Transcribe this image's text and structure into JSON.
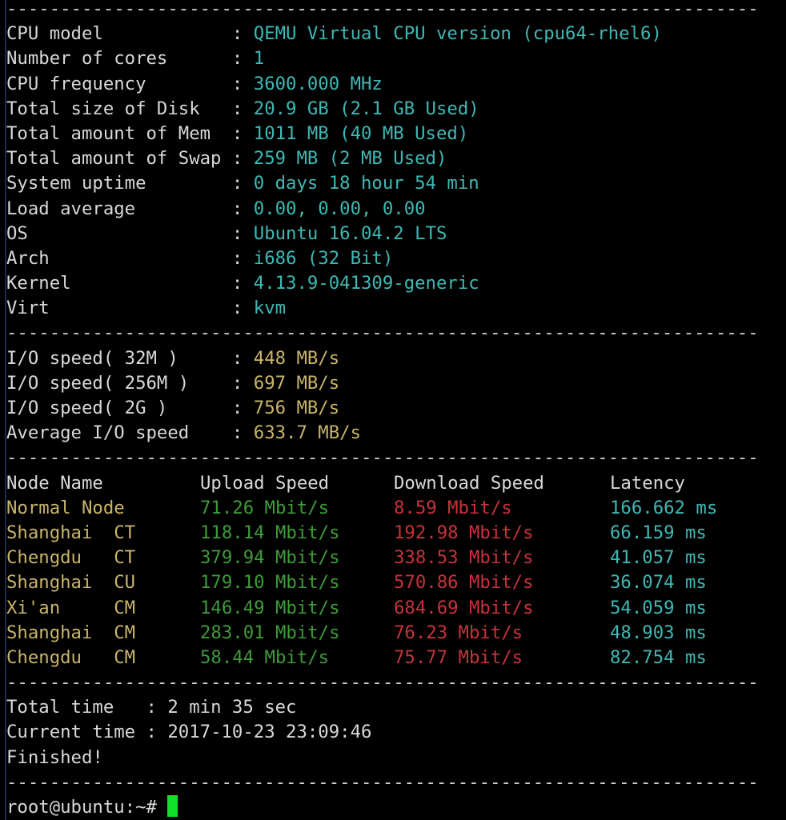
{
  "separator": "----------------------------------------------------------------------",
  "system_info": [
    {
      "label": "CPU model           ",
      "value": "QEMU Virtual CPU version (cpu64-rhel6)"
    },
    {
      "label": "Number of cores     ",
      "value": "1"
    },
    {
      "label": "CPU frequency       ",
      "value": "3600.000 MHz"
    },
    {
      "label": "Total size of Disk  ",
      "value": "20.9 GB (2.1 GB Used)"
    },
    {
      "label": "Total amount of Mem ",
      "value": "1011 MB (40 MB Used)"
    },
    {
      "label": "Total amount of Swap",
      "value": "259 MB (2 MB Used)"
    },
    {
      "label": "System uptime       ",
      "value": "0 days 18 hour 54 min"
    },
    {
      "label": "Load average        ",
      "value": "0.00, 0.00, 0.00"
    },
    {
      "label": "OS                  ",
      "value": "Ubuntu 16.04.2 LTS"
    },
    {
      "label": "Arch                ",
      "value": "i686 (32 Bit)"
    },
    {
      "label": "Kernel              ",
      "value": "4.13.9-041309-generic"
    },
    {
      "label": "Virt                ",
      "value": "kvm"
    }
  ],
  "io_info": [
    {
      "label": "I/O speed( 32M )    ",
      "value": "448 MB/s"
    },
    {
      "label": "I/O speed( 256M )   ",
      "value": "697 MB/s"
    },
    {
      "label": "I/O speed( 2G )     ",
      "value": "756 MB/s"
    },
    {
      "label": "Average I/O speed   ",
      "value": "633.7 MB/s"
    }
  ],
  "colon": " : ",
  "speed_table": {
    "headers": [
      "Node Name",
      "Upload Speed",
      "Download Speed",
      "Latency"
    ],
    "rows": [
      {
        "node": "Normal Node",
        "upload": "71.26 Mbit/s",
        "download": "8.59 Mbit/s",
        "latency": "166.662 ms"
      },
      {
        "node": "Shanghai  CT",
        "upload": "118.14 Mbit/s",
        "download": "192.98 Mbit/s",
        "latency": "66.159 ms"
      },
      {
        "node": "Chengdu   CT",
        "upload": "379.94 Mbit/s",
        "download": "338.53 Mbit/s",
        "latency": "41.057 ms"
      },
      {
        "node": "Shanghai  CU",
        "upload": "179.10 Mbit/s",
        "download": "570.86 Mbit/s",
        "latency": "36.074 ms"
      },
      {
        "node": "Xi'an     CM",
        "upload": "146.49 Mbit/s",
        "download": "684.69 Mbit/s",
        "latency": "54.059 ms"
      },
      {
        "node": "Shanghai  CM",
        "upload": "283.01 Mbit/s",
        "download": "76.23 Mbit/s",
        "latency": "48.903 ms"
      },
      {
        "node": "Chengdu   CM",
        "upload": "58.44 Mbit/s",
        "download": "75.77 Mbit/s",
        "latency": "82.754 ms"
      }
    ]
  },
  "summary": [
    {
      "label": "Total time  ",
      "value": "2 min 35 sec"
    },
    {
      "label": "Current time",
      "value": "2017-10-23 23:09:46"
    }
  ],
  "finished": "Finished!",
  "prompt": "root@ubuntu:~# ",
  "colors": {
    "value": "#3eb8b4",
    "io": "#c9b46a",
    "node": "#c9b46a",
    "upload": "#3f9a3a",
    "download": "#c8323a",
    "latency": "#3eb8b4",
    "cursor": "#11e02a"
  }
}
